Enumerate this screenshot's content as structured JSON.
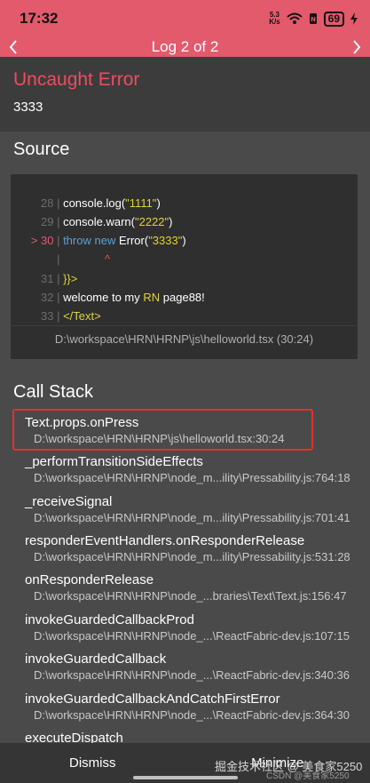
{
  "status_bar": {
    "time": "17:32",
    "net_speed_top": "5.3",
    "net_speed_bottom": "K/s",
    "battery": "69"
  },
  "header": {
    "title": "Log 2 of 2"
  },
  "error": {
    "title": "Uncaught Error",
    "message": "3333"
  },
  "source": {
    "title": "Source",
    "lines": [
      {
        "num": "28",
        "text": "console.log(\"1111\")"
      },
      {
        "num": "29",
        "text": "console.warn(\"2222\")"
      },
      {
        "num": "> 30",
        "text": "throw new Error(\"3333\")"
      },
      {
        "num": "",
        "text": "^"
      },
      {
        "num": "31",
        "text": "}}>"
      },
      {
        "num": "32",
        "text": "welcome to my RN page88!"
      },
      {
        "num": "33",
        "text": "</Text>"
      }
    ],
    "file": "D:\\workspace\\HRN\\HRNP\\js\\helloworld.tsx (30:24)"
  },
  "call_stack": {
    "title": "Call Stack",
    "frames": [
      {
        "name": "Text.props.onPress",
        "path": "D:\\workspace\\HRN\\HRNP\\js\\helloworld.tsx:30:24"
      },
      {
        "name": "_performTransitionSideEffects",
        "path": "D:\\workspace\\HRN\\HRNP\\node_m...ility\\Pressability.js:764:18"
      },
      {
        "name": "_receiveSignal",
        "path": "D:\\workspace\\HRN\\HRNP\\node_m...ility\\Pressability.js:701:41"
      },
      {
        "name": "responderEventHandlers.onResponderRelease",
        "path": "D:\\workspace\\HRN\\HRNP\\node_m...ility\\Pressability.js:531:28"
      },
      {
        "name": "onResponderRelease",
        "path": "D:\\workspace\\HRN\\HRNP\\node_...braries\\Text\\Text.js:156:47"
      },
      {
        "name": "invokeGuardedCallbackProd",
        "path": "D:\\workspace\\HRN\\HRNP\\node_...\\ReactFabric-dev.js:107:15"
      },
      {
        "name": "invokeGuardedCallback",
        "path": "D:\\workspace\\HRN\\HRNP\\node_...\\ReactFabric-dev.js:340:36"
      },
      {
        "name": "invokeGuardedCallbackAndCatchFirstError",
        "path": "D:\\workspace\\HRN\\HRNP\\node_...\\ReactFabric-dev.js:364:30"
      },
      {
        "name": "executeDispatch",
        "path": ""
      }
    ]
  },
  "bottom": {
    "dismiss": "Dismiss",
    "minimize": "Minimize"
  },
  "watermark": {
    "main": "掘金技术社区 @ 美食家5250",
    "csdn": "CSDN @美食家5250"
  }
}
